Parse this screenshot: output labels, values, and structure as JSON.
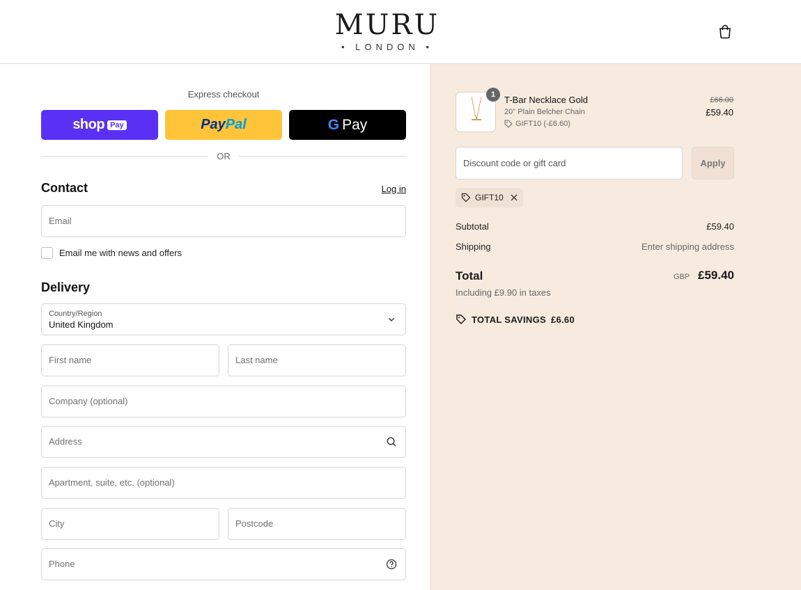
{
  "brand": {
    "name": "MURU",
    "sub": "• LONDON •"
  },
  "express": {
    "title": "Express checkout",
    "shop_label": "shop",
    "shop_pay_badge": "Pay",
    "paypal_part1": "Pay",
    "paypal_part2": "Pal",
    "gpay_g": "G",
    "gpay_label": "Pay",
    "or_text": "OR"
  },
  "contact": {
    "title": "Contact",
    "login_label": "Log in",
    "email_placeholder": "Email",
    "newsletter_label": "Email me with news and offers"
  },
  "delivery": {
    "title": "Delivery",
    "country_label": "Country/Region",
    "country_value": "United Kingdom",
    "first_name_placeholder": "First name",
    "last_name_placeholder": "Last name",
    "company_placeholder": "Company (optional)",
    "address_placeholder": "Address",
    "apartment_placeholder": "Apartment, suite, etc. (optional)",
    "city_placeholder": "City",
    "postcode_placeholder": "Postcode",
    "phone_placeholder": "Phone"
  },
  "order": {
    "product_name": "T-Bar Necklace Gold",
    "product_variant": "20\" Plain Belcher Chain",
    "product_discount": "GIFT10 (-£6.60)",
    "quantity": "1",
    "price_old": "£66.00",
    "price_new": "£59.40",
    "discount_placeholder": "Discount code or gift card",
    "apply_label": "Apply",
    "gift_code": "GIFT10",
    "subtotal_label": "Subtotal",
    "subtotal_value": "£59.40",
    "shipping_label": "Shipping",
    "shipping_value": "Enter shipping address",
    "total_label": "Total",
    "total_currency": "GBP",
    "total_value": "£59.40",
    "tax_note": "Including £9.90 in taxes",
    "savings_label": "TOTAL SAVINGS",
    "savings_value": "£6.60"
  },
  "colors": {
    "shop_pay": "#5a31f4",
    "paypal": "#ffc439",
    "gpay": "#000000",
    "summary_bg": "#f7ebe0"
  }
}
